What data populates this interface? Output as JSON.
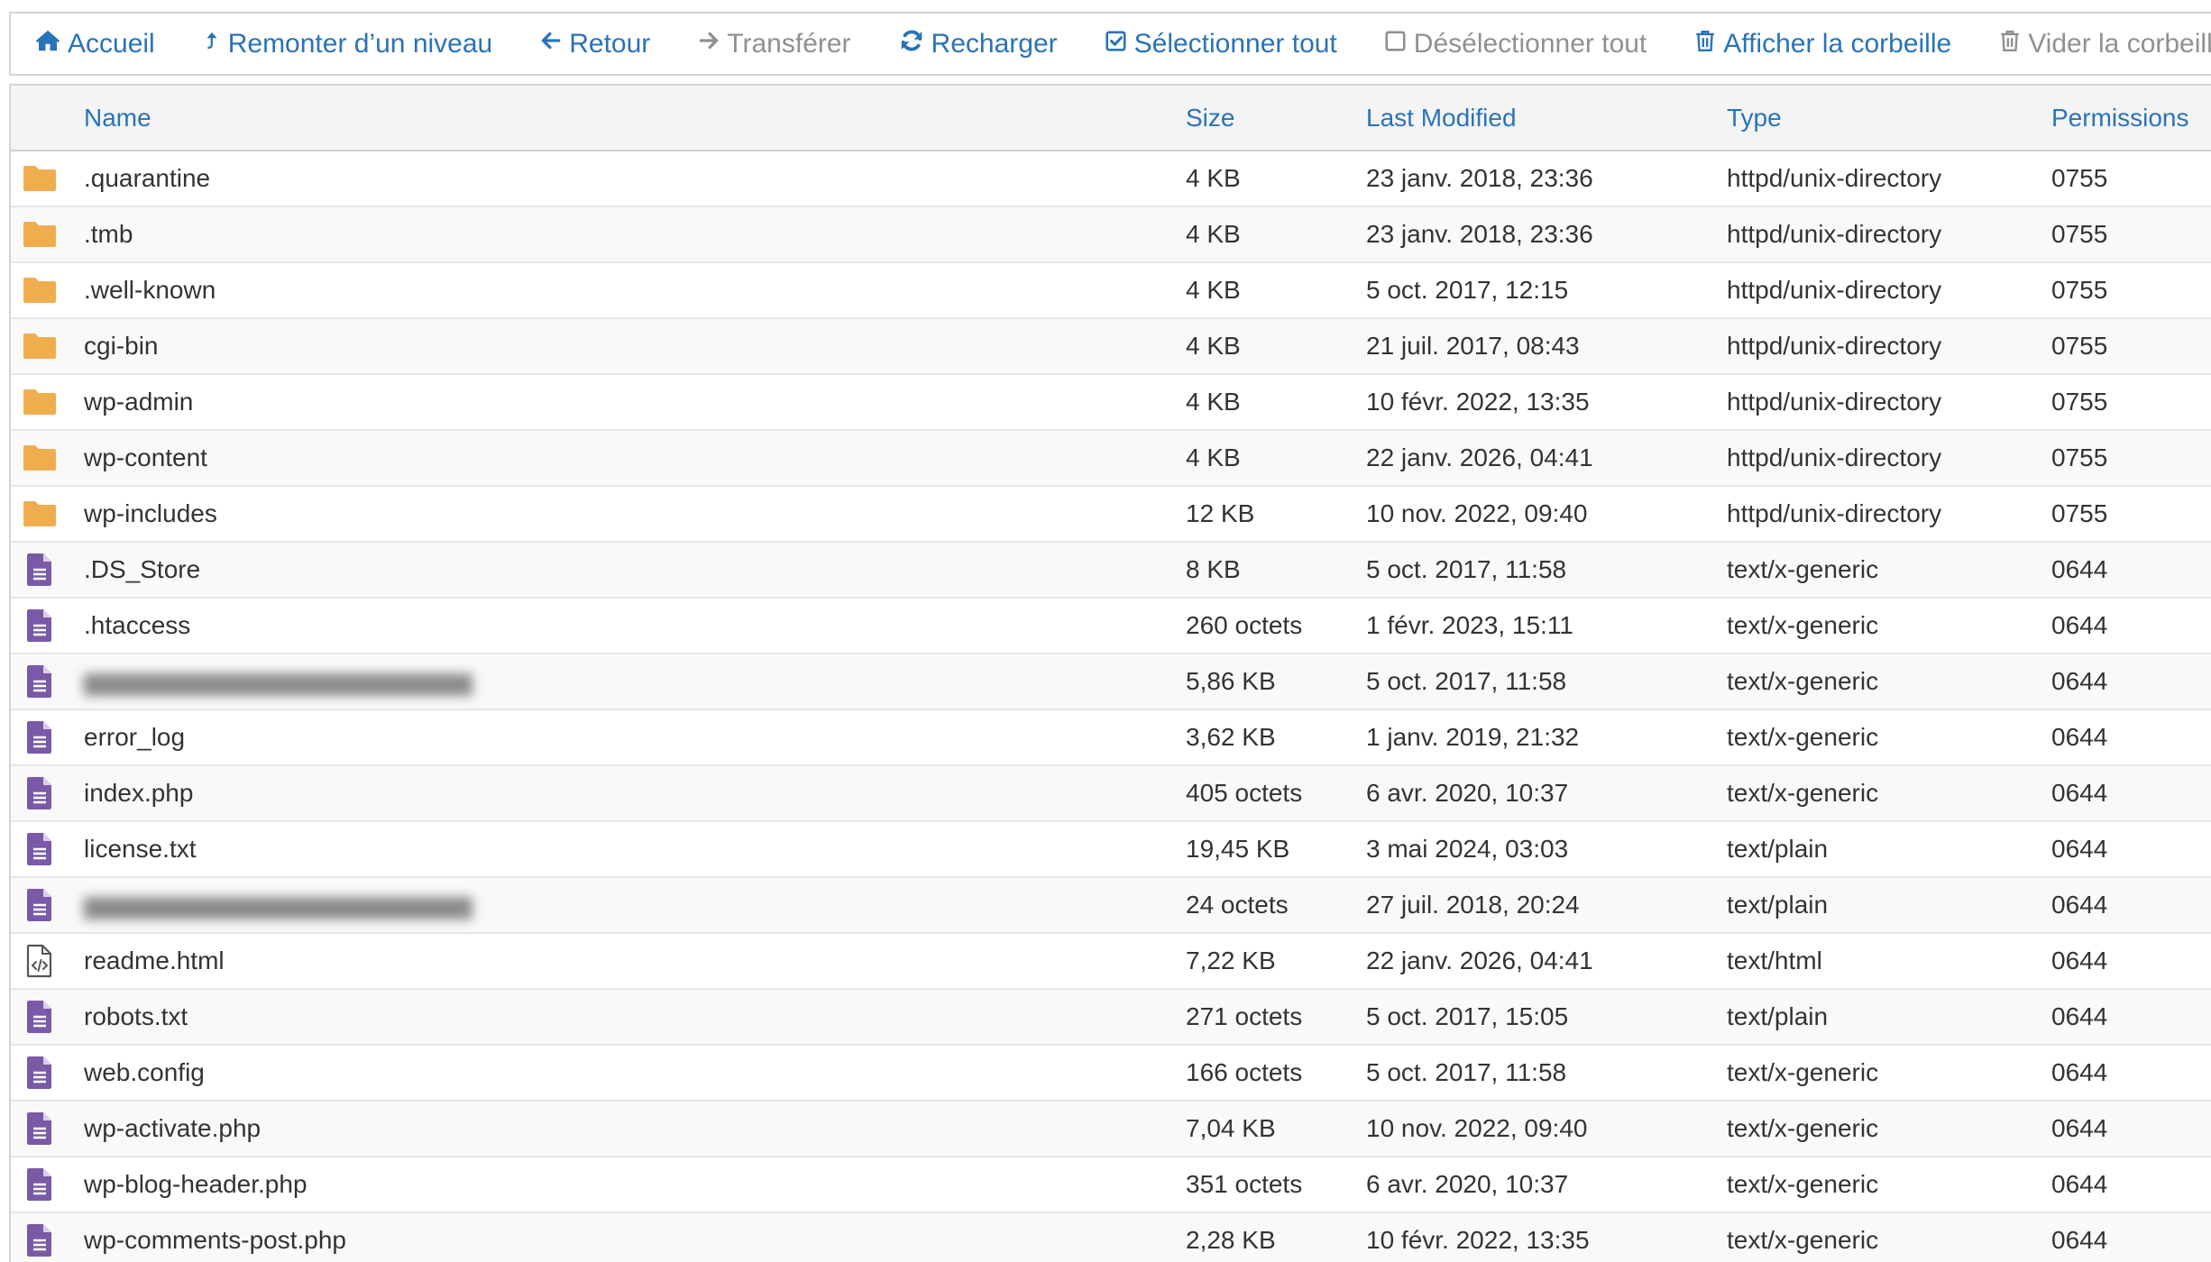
{
  "toolbar": {
    "items": [
      {
        "id": "home",
        "icon": "home-icon",
        "label": "Accueil",
        "enabled": true
      },
      {
        "id": "up",
        "icon": "level-up-icon",
        "label": "Remonter d’un niveau",
        "enabled": true
      },
      {
        "id": "back",
        "icon": "arrow-left-icon",
        "label": "Retour",
        "enabled": true
      },
      {
        "id": "forward",
        "icon": "arrow-right-icon",
        "label": "Transférer",
        "enabled": false
      },
      {
        "id": "reload",
        "icon": "refresh-icon",
        "label": "Recharger",
        "enabled": true
      },
      {
        "id": "select-all",
        "icon": "checked-box-icon",
        "label": "Sélectionner tout",
        "enabled": true
      },
      {
        "id": "deselect-all",
        "icon": "empty-box-icon",
        "label": "Désélectionner tout",
        "enabled": false
      },
      {
        "id": "show-trash",
        "icon": "trash-icon",
        "label": "Afficher la corbeille",
        "enabled": true
      },
      {
        "id": "empty-trash",
        "icon": "trash-icon",
        "label": "Vider la corbeille",
        "enabled": false
      }
    ]
  },
  "columns": {
    "name": "Name",
    "size": "Size",
    "modified": "Last Modified",
    "type": "Type",
    "permissions": "Permissions"
  },
  "colors": {
    "accent": "#2a73b8",
    "folder": "#f0ad4e",
    "file": "#7a5aa6",
    "disabled": "#909090"
  },
  "files": [
    {
      "icon": "folder-icon",
      "name": ".quarantine",
      "size": "4 KB",
      "modified": "23 janv. 2018, 23:36",
      "type": "httpd/unix-directory",
      "perm": "0755"
    },
    {
      "icon": "folder-icon",
      "name": ".tmb",
      "size": "4 KB",
      "modified": "23 janv. 2018, 23:36",
      "type": "httpd/unix-directory",
      "perm": "0755"
    },
    {
      "icon": "folder-icon",
      "name": ".well-known",
      "size": "4 KB",
      "modified": "5 oct. 2017, 12:15",
      "type": "httpd/unix-directory",
      "perm": "0755"
    },
    {
      "icon": "folder-icon",
      "name": "cgi-bin",
      "size": "4 KB",
      "modified": "21 juil. 2017, 08:43",
      "type": "httpd/unix-directory",
      "perm": "0755"
    },
    {
      "icon": "folder-icon",
      "name": "wp-admin",
      "size": "4 KB",
      "modified": "10 févr. 2022, 13:35",
      "type": "httpd/unix-directory",
      "perm": "0755"
    },
    {
      "icon": "folder-icon",
      "name": "wp-content",
      "size": "4 KB",
      "modified": "22 janv. 2026, 04:41",
      "type": "httpd/unix-directory",
      "perm": "0755"
    },
    {
      "icon": "folder-icon",
      "name": "wp-includes",
      "size": "12 KB",
      "modified": "10 nov. 2022, 09:40",
      "type": "httpd/unix-directory",
      "perm": "0755"
    },
    {
      "icon": "file-text-icon",
      "name": ".DS_Store",
      "size": "8 KB",
      "modified": "5 oct. 2017, 11:58",
      "type": "text/x-generic",
      "perm": "0644"
    },
    {
      "icon": "file-text-icon",
      "name": ".htaccess",
      "size": "260 octets",
      "modified": "1 févr. 2023, 15:11",
      "type": "text/x-generic",
      "perm": "0644"
    },
    {
      "icon": "file-text-icon",
      "name": "",
      "blurred": true,
      "size": "5,86 KB",
      "modified": "5 oct. 2017, 11:58",
      "type": "text/x-generic",
      "perm": "0644"
    },
    {
      "icon": "file-text-icon",
      "name": "error_log",
      "size": "3,62 KB",
      "modified": "1 janv. 2019, 21:32",
      "type": "text/x-generic",
      "perm": "0644"
    },
    {
      "icon": "file-text-icon",
      "name": "index.php",
      "size": "405 octets",
      "modified": "6 avr. 2020, 10:37",
      "type": "text/x-generic",
      "perm": "0644"
    },
    {
      "icon": "file-text-icon",
      "name": "license.txt",
      "size": "19,45 KB",
      "modified": "3 mai 2024, 03:03",
      "type": "text/plain",
      "perm": "0644"
    },
    {
      "icon": "file-text-icon",
      "name": "",
      "blurred": true,
      "size": "24 octets",
      "modified": "27 juil. 2018, 20:24",
      "type": "text/plain",
      "perm": "0644"
    },
    {
      "icon": "file-code-icon",
      "name": "readme.html",
      "size": "7,22 KB",
      "modified": "22 janv. 2026, 04:41",
      "type": "text/html",
      "perm": "0644"
    },
    {
      "icon": "file-text-icon",
      "name": "robots.txt",
      "size": "271 octets",
      "modified": "5 oct. 2017, 15:05",
      "type": "text/plain",
      "perm": "0644"
    },
    {
      "icon": "file-text-icon",
      "name": "web.config",
      "size": "166 octets",
      "modified": "5 oct. 2017, 11:58",
      "type": "text/x-generic",
      "perm": "0644"
    },
    {
      "icon": "file-text-icon",
      "name": "wp-activate.php",
      "size": "7,04 KB",
      "modified": "10 nov. 2022, 09:40",
      "type": "text/x-generic",
      "perm": "0644"
    },
    {
      "icon": "file-text-icon",
      "name": "wp-blog-header.php",
      "size": "351 octets",
      "modified": "6 avr. 2020, 10:37",
      "type": "text/x-generic",
      "perm": "0644"
    },
    {
      "icon": "file-text-icon",
      "name": "wp-comments-post.php",
      "size": "2,28 KB",
      "modified": "10 févr. 2022, 13:35",
      "type": "text/x-generic",
      "perm": "0644"
    }
  ]
}
